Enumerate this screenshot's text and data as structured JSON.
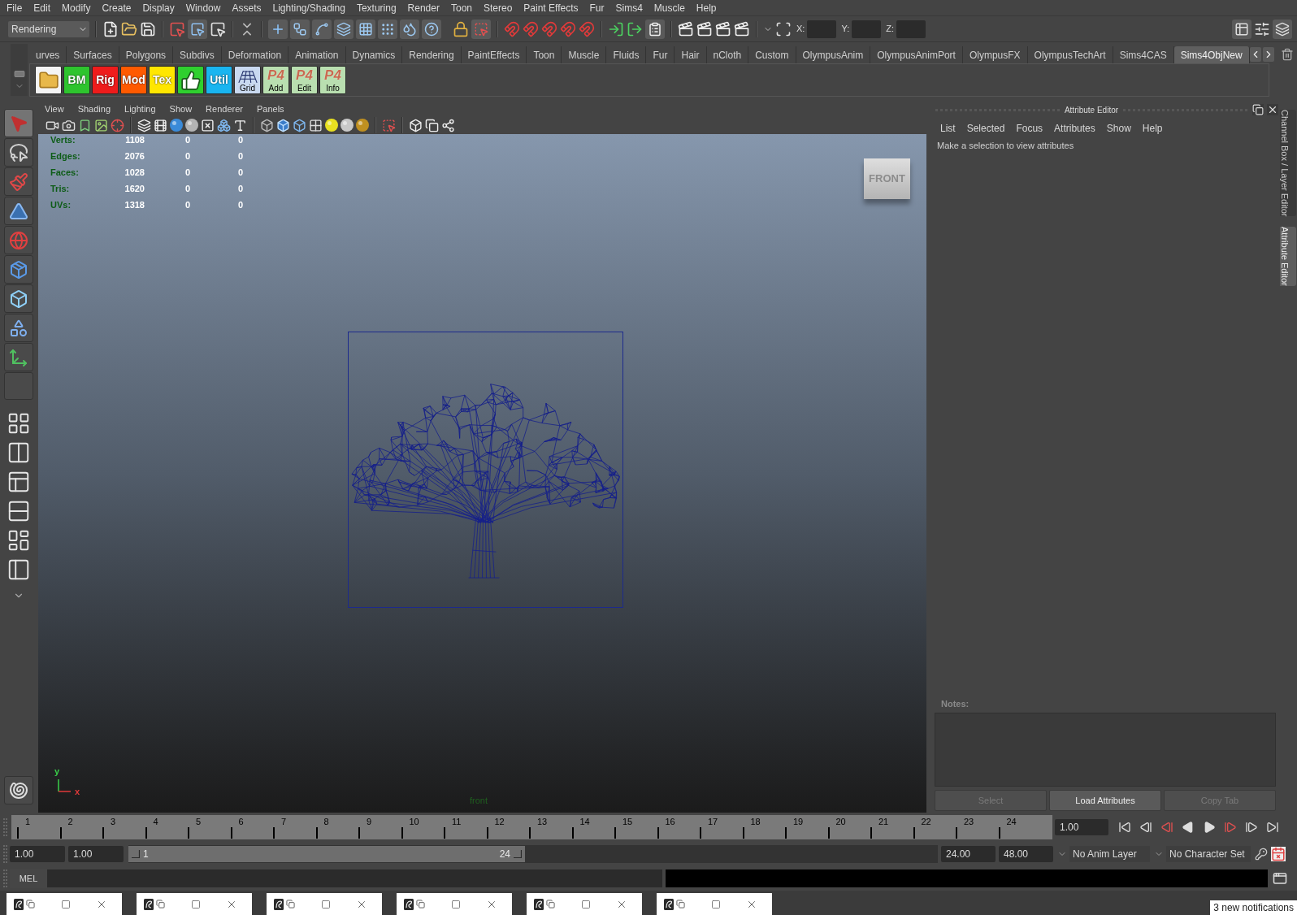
{
  "menu_bar": [
    "File",
    "Edit",
    "Modify",
    "Create",
    "Display",
    "Window",
    "Assets",
    "Lighting/Shading",
    "Texturing",
    "Render",
    "Toon",
    "Stereo",
    "Paint Effects",
    "Fur",
    "Sims4",
    "Muscle",
    "Help"
  ],
  "status_line": {
    "menu_set": "Rendering",
    "coordinates": [
      "X:",
      "Y:",
      "Z:"
    ]
  },
  "shelf": {
    "tabs": [
      {
        "label": "urves",
        "selected": false
      },
      {
        "label": "Surfaces",
        "selected": false
      },
      {
        "label": "Polygons",
        "selected": false
      },
      {
        "label": "Subdivs",
        "selected": false
      },
      {
        "label": "Deformation",
        "selected": false
      },
      {
        "label": "Animation",
        "selected": false
      },
      {
        "label": "Dynamics",
        "selected": false
      },
      {
        "label": "Rendering",
        "selected": false
      },
      {
        "label": "PaintEffects",
        "selected": false
      },
      {
        "label": "Toon",
        "selected": false
      },
      {
        "label": "Muscle",
        "selected": false
      },
      {
        "label": "Fluids",
        "selected": false
      },
      {
        "label": "Fur",
        "selected": false
      },
      {
        "label": "Hair",
        "selected": false
      },
      {
        "label": "nCloth",
        "selected": false
      },
      {
        "label": "Custom",
        "selected": false
      },
      {
        "label": "OlympusAnim",
        "selected": false
      },
      {
        "label": "OlympusAnimPort",
        "selected": false
      },
      {
        "label": "OlympusFX",
        "selected": false
      },
      {
        "label": "OlympusTechArt",
        "selected": false
      },
      {
        "label": "Sims4CAS",
        "selected": false
      },
      {
        "label": "Sims4ObjNew",
        "selected": true
      }
    ],
    "buttons": [
      {
        "kind": "icon",
        "color": "#f4f4f4"
      },
      {
        "kind": "text",
        "label": "BM",
        "color": "#2ec42e"
      },
      {
        "kind": "text",
        "label": "Rig",
        "color": "#ee1c1c"
      },
      {
        "kind": "text",
        "label": "Mod",
        "color": "#ff5a00"
      },
      {
        "kind": "text",
        "label": "Tex",
        "color": "#ffe600"
      },
      {
        "kind": "icon",
        "color": "#2fd02f"
      },
      {
        "kind": "text",
        "label": "Util",
        "color": "#19b5f0"
      },
      {
        "kind": "grid",
        "label": "Grid",
        "color": "#c9d9f0"
      },
      {
        "kind": "logo",
        "logo": "P4",
        "label": "Add",
        "color": "#b9dfb0"
      },
      {
        "kind": "logo",
        "logo": "P4",
        "label": "Edit",
        "color": "#b9dfb0"
      },
      {
        "kind": "logo",
        "logo": "P4",
        "label": "Info",
        "color": "#b9dfb0"
      }
    ]
  },
  "toolbox": {
    "tools": [
      {
        "selected": true
      },
      {
        "selected": false
      },
      {
        "selected": false
      },
      {
        "selected": false
      },
      {
        "selected": false
      },
      {
        "selected": false
      },
      {
        "selected": false
      },
      {
        "selected": false
      },
      {
        "selected": false
      }
    ]
  },
  "viewport": {
    "menu": [
      "View",
      "Shading",
      "Lighting",
      "Show",
      "Renderer",
      "Panels"
    ],
    "hud": [
      {
        "label": "Verts:",
        "values": [
          "1108",
          "0",
          "0"
        ]
      },
      {
        "label": "Edges:",
        "values": [
          "2076",
          "0",
          "0"
        ]
      },
      {
        "label": "Faces:",
        "values": [
          "1028",
          "0",
          "0"
        ]
      },
      {
        "label": "Tris:",
        "values": [
          "1620",
          "0",
          "0"
        ]
      },
      {
        "label": "UVs:",
        "values": [
          "1318",
          "0",
          "0"
        ]
      }
    ],
    "view_cube": "FRONT",
    "axis": {
      "y": "y",
      "x": "x"
    },
    "camera": "front"
  },
  "attribute_editor": {
    "title": "Attribute Editor",
    "menu": [
      "List",
      "Selected",
      "Focus",
      "Attributes",
      "Show",
      "Help"
    ],
    "message": "Make a selection to view attributes",
    "notes_label": "Notes:",
    "buttons": [
      {
        "label": "Select",
        "disabled": true
      },
      {
        "label": "Load Attributes",
        "disabled": false
      },
      {
        "label": "Copy Tab",
        "disabled": true
      }
    ]
  },
  "side_tabs": [
    {
      "label": "Channel Box / Layer Editor",
      "selected": false
    },
    {
      "label": "Attribute Editor",
      "selected": true
    }
  ],
  "time_slider": {
    "ticks": [
      "1",
      "2",
      "3",
      "4",
      "5",
      "6",
      "7",
      "8",
      "9",
      "10",
      "11",
      "12",
      "13",
      "14",
      "15",
      "16",
      "17",
      "18",
      "19",
      "20",
      "21",
      "22",
      "23",
      "24"
    ],
    "current_time": "1.00"
  },
  "range_slider": {
    "start_time": "1.00",
    "playback_start": "1.00",
    "range_start": "1",
    "range_end": "24",
    "playback_end": "24.00",
    "end_time": "48.00",
    "anim_layer": "No Anim Layer",
    "character_set": "No Character Set"
  },
  "command_line": {
    "language": "MEL"
  },
  "taskbar": {
    "notification": "3 new notifications"
  }
}
